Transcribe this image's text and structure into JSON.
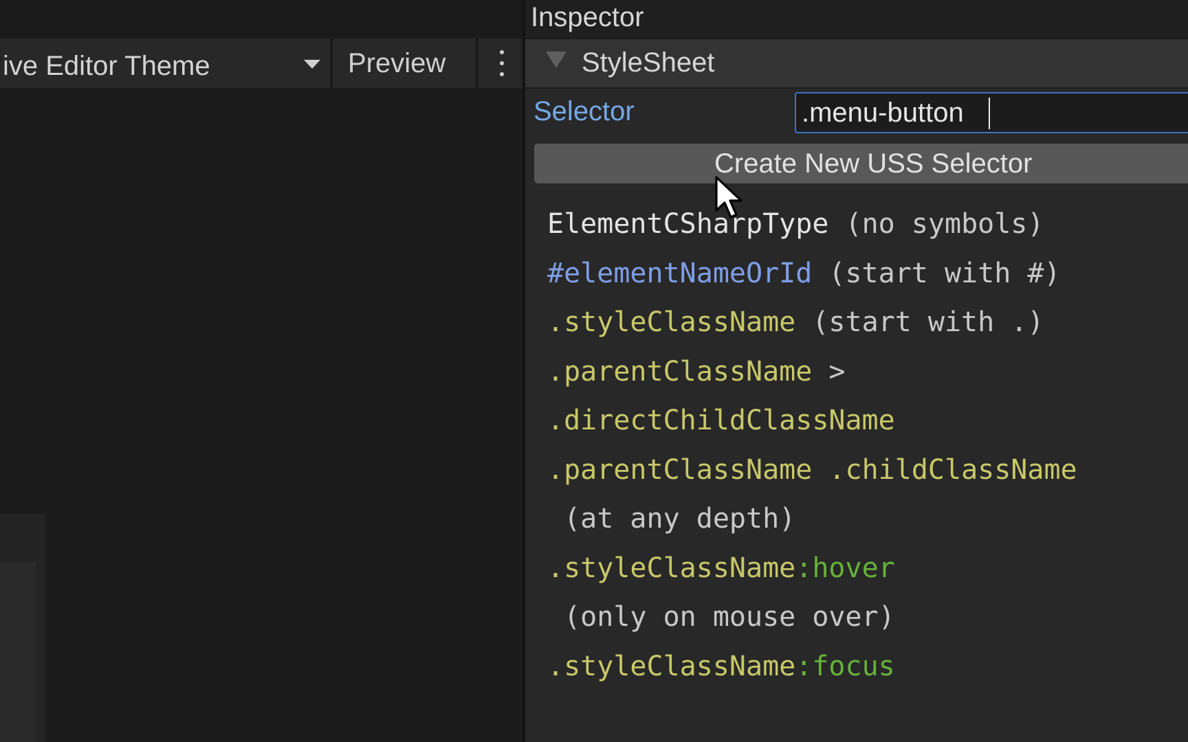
{
  "left_panel": {
    "theme_dropdown_label": "ive Editor Theme",
    "preview_label": "Preview"
  },
  "inspector": {
    "title": "Inspector",
    "foldout_label": "StyleSheet",
    "selector_label": "Selector",
    "selector_value": ".menu-button",
    "create_button_label": "Create New USS Selector",
    "help_lines": [
      [
        {
          "text": "ElementCSharpType",
          "color": "white"
        },
        {
          "text": " (no symbols)",
          "color": "gray"
        }
      ],
      [
        {
          "text": "#elementNameOrId",
          "color": "blue"
        },
        {
          "text": " (start with #)",
          "color": "gray"
        }
      ],
      [
        {
          "text": ".styleClassName",
          "color": "olive"
        },
        {
          "text": " (start with .)",
          "color": "gray"
        }
      ],
      [
        {
          "text": ".parentClassName",
          "color": "olive"
        },
        {
          "text": " >",
          "color": "gray"
        }
      ],
      [
        {
          "text": ".directChildClassName",
          "color": "olive"
        }
      ],
      [
        {
          "text": ".parentClassName",
          "color": "olive"
        },
        {
          "text": " ",
          "color": "gray"
        },
        {
          "text": ".childClassName",
          "color": "olive"
        }
      ],
      [
        {
          "text": " (at any depth)",
          "color": "gray"
        }
      ],
      [
        {
          "text": ".styleClassName",
          "color": "olive"
        },
        {
          "text": ":hover",
          "color": "green"
        }
      ],
      [
        {
          "text": " (only on mouse over)",
          "color": "gray"
        }
      ],
      [
        {
          "text": ".styleClassName",
          "color": "olive"
        },
        {
          "text": ":focus",
          "color": "green"
        }
      ]
    ]
  },
  "colors": {
    "selector_label": "#76a8e6",
    "input_focus_border": "#3d74c2",
    "type_text": "#e4e4e4",
    "id_text": "#7f9ee6",
    "class_text": "#c8c86a",
    "pseudo_text": "#66b23a",
    "note_text": "#c8c8c8"
  },
  "icons": {
    "dropdown": "chevron-down-icon",
    "more": "kebab-menu-icon",
    "foldout": "triangle-down-icon",
    "pointer": "mouse-cursor-icon"
  }
}
